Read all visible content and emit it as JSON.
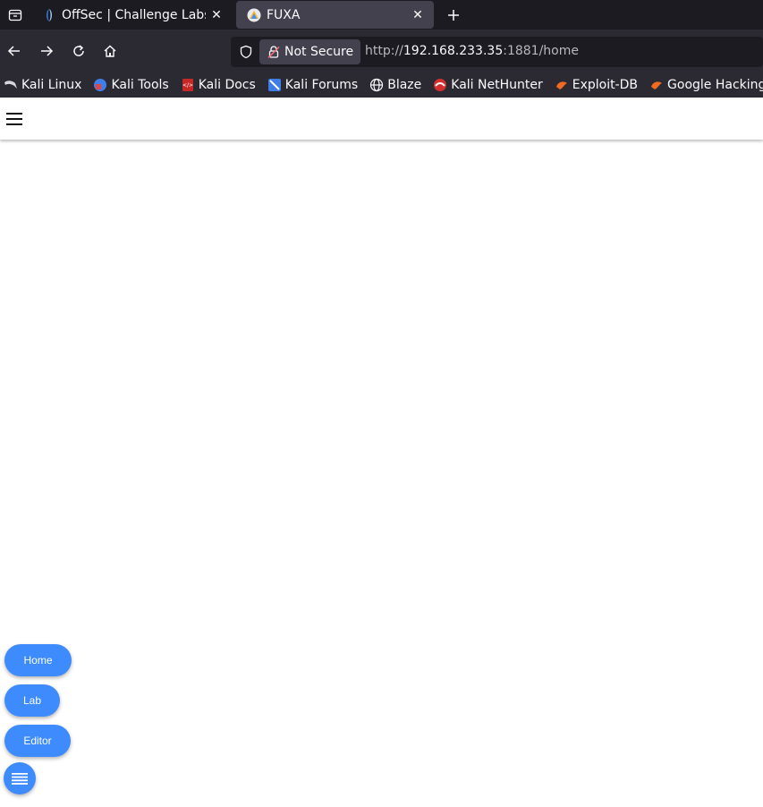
{
  "browser": {
    "tabs": [
      {
        "title": "OffSec | Challenge Labs",
        "active": false,
        "favicon": "offsec-icon"
      },
      {
        "title": "FUXA",
        "active": true,
        "favicon": "fuxa-icon"
      }
    ],
    "security_label": "Not Secure",
    "url": {
      "scheme": "http://",
      "host": "192.168.233.35",
      "rest": ":1881/home"
    },
    "bookmarks": [
      {
        "label": "Kali Linux",
        "icon": "kali-dragon-icon"
      },
      {
        "label": "Kali Tools",
        "icon": "kali-tools-icon"
      },
      {
        "label": "Kali Docs",
        "icon": "kali-docs-icon"
      },
      {
        "label": "Kali Forums",
        "icon": "kali-forums-icon"
      },
      {
        "label": "Blaze",
        "icon": "globe-icon"
      },
      {
        "label": "Kali NetHunter",
        "icon": "nethunter-icon"
      },
      {
        "label": "Exploit-DB",
        "icon": "exploit-db-icon"
      },
      {
        "label": "Google Hacking DB",
        "icon": "ghdb-icon"
      }
    ]
  },
  "app": {
    "fab_buttons": [
      {
        "label": "Home"
      },
      {
        "label": "Lab"
      },
      {
        "label": "Editor"
      }
    ]
  },
  "colors": {
    "fab": "#3d8bfd",
    "tabstrip": "#1c1b22",
    "toolbar": "#2b2a33"
  }
}
